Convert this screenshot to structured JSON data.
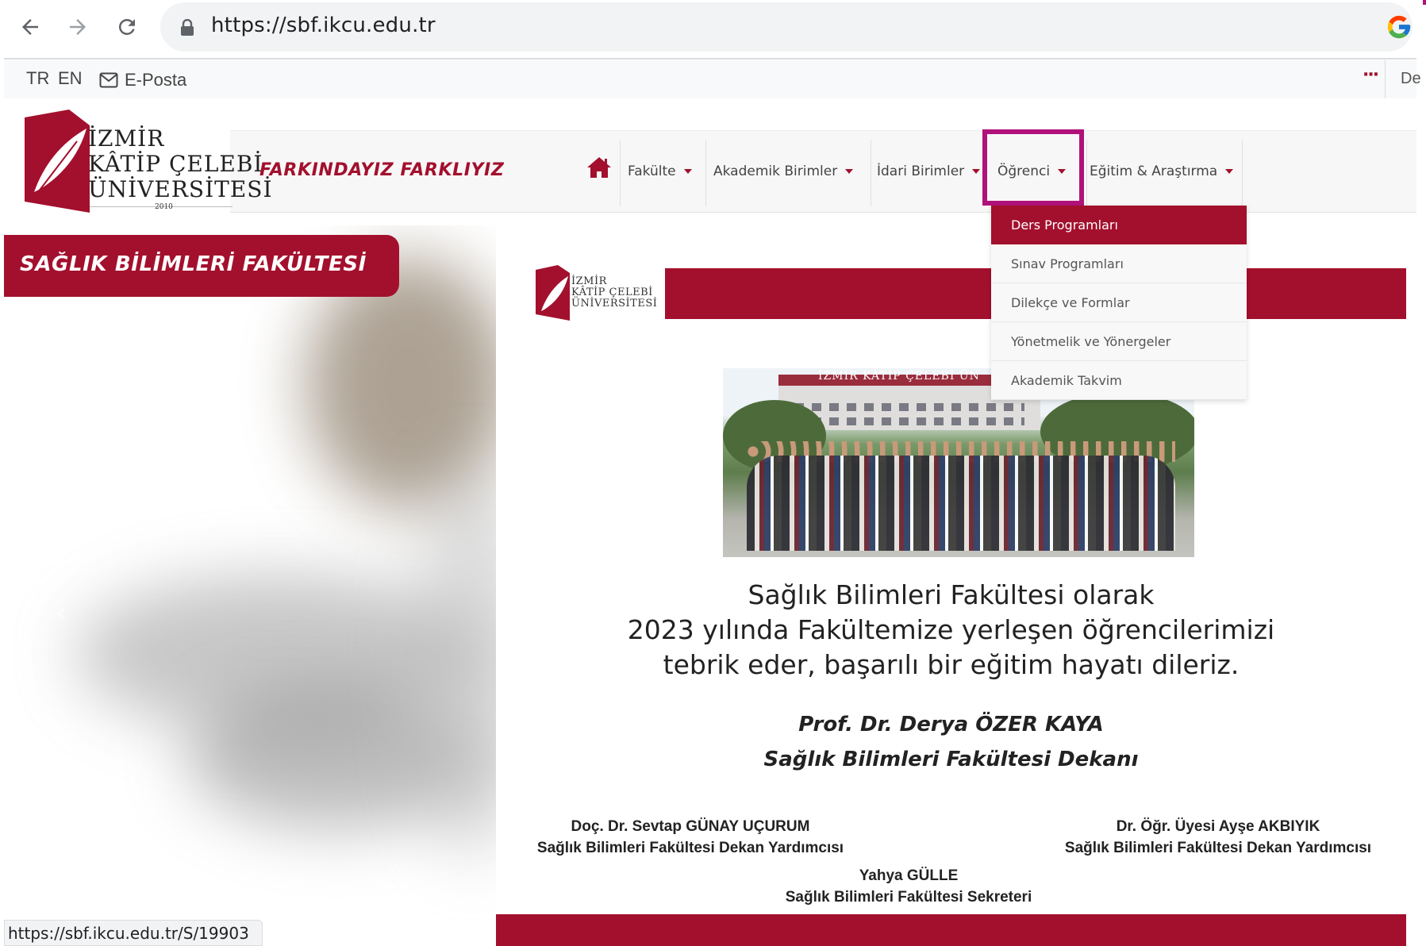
{
  "browser": {
    "url": "https://sbf.ikcu.edu.tr",
    "status_url": "https://sbf.ikcu.edu.tr/S/19903"
  },
  "topbar": {
    "lang_tr": "TR",
    "lang_en": "EN",
    "email_label": "E-Posta",
    "more_label": "···",
    "cut_text": "De"
  },
  "header": {
    "logo_lines": [
      "İZMİR",
      "KÂTİP ÇELEBİ",
      "ÜNİVERSİTESİ"
    ],
    "logo_year": "2010",
    "slogan": "FARKINDAYIZ FARKLIYIZ"
  },
  "nav": {
    "items": [
      {
        "label": "Fakülte"
      },
      {
        "label": "Akademik Birimler"
      },
      {
        "label": "İdari Birimler"
      },
      {
        "label": "Öğrenci"
      },
      {
        "label": "Eğitim & Araştırma"
      }
    ],
    "dropdown": [
      {
        "label": "Ders Programları",
        "active": true
      },
      {
        "label": "Sınav Programları"
      },
      {
        "label": "Dilekçe ve Formlar"
      },
      {
        "label": "Yönetmelik ve Yönergeler"
      },
      {
        "label": "Akademik Takvim"
      }
    ]
  },
  "faculty_badge": "SAĞLIK BİLİMLERİ FAKÜLTESİ",
  "announcement": {
    "logo_lines": [
      "İZMİR",
      "KÂTİP ÇELEBİ",
      "ÜNİVERSİTESİ"
    ],
    "photo_sign": "İZMİR KÂTİP ÇELEBİ ÜN",
    "message_lines": [
      "Sağlık Bilimleri Fakültesi olarak",
      "2023 yılında Fakültemize yerleşen öğrencilerimizi",
      "tebrik eder, başarılı bir eğitim hayatı dileriz."
    ],
    "dean_name": "Prof. Dr. Derya ÖZER KAYA",
    "dean_title": "Sağlık Bilimleri Fakültesi Dekanı",
    "signatures": [
      {
        "name": "Doç. Dr. Sevtap GÜNAY UÇURUM",
        "title": "Sağlık Bilimleri Fakültesi Dekan Yardımcısı"
      },
      {
        "name": "Dr. Öğr. Üyesi Ayşe AKBIYIK",
        "title": "Sağlık Bilimleri Fakültesi Dekan Yardımcısı"
      },
      {
        "name": "Yahya GÜLLE",
        "title": "Sağlık Bilimleri Fakültesi Sekreteri"
      }
    ]
  },
  "colors": {
    "brand": "#a3102d",
    "highlight": "#b0127a"
  }
}
